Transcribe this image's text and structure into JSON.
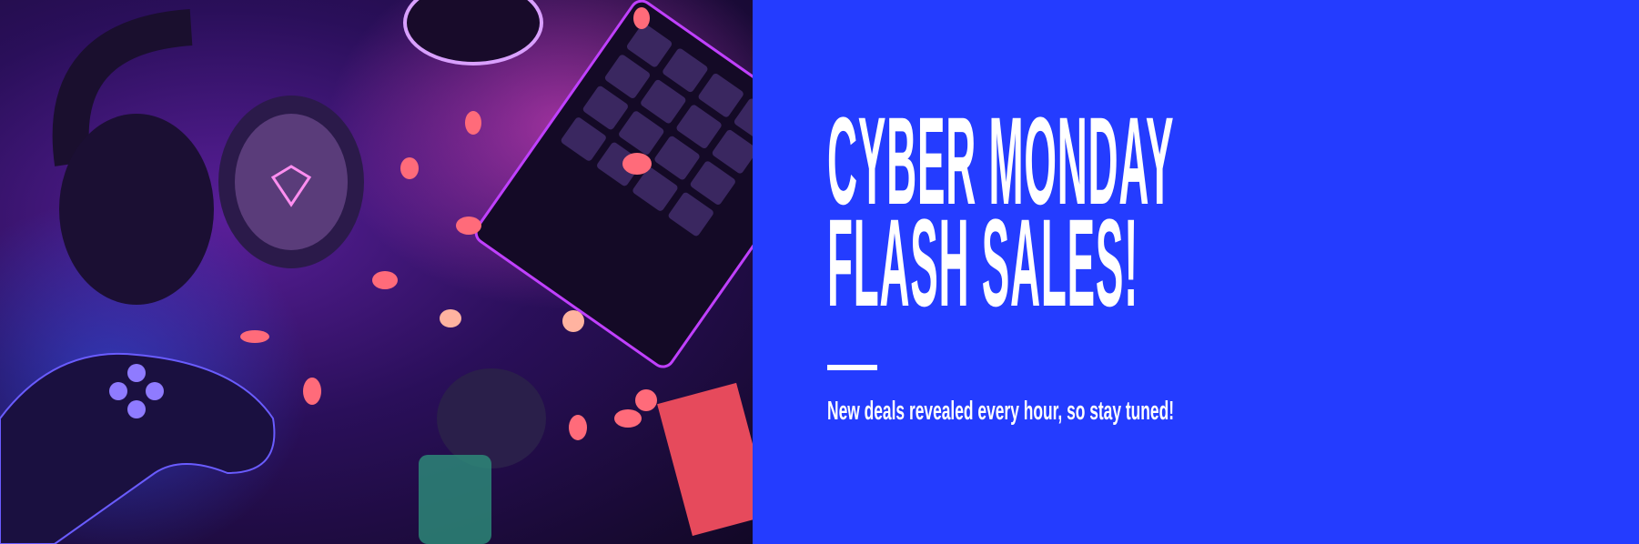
{
  "banner": {
    "title_line1": "CYBER MONDAY",
    "title_line2": "FLASH SALES!",
    "subtitle": "New deals revealed every hour, so stay tuned!",
    "background_color": "#243cff",
    "text_color": "#ffffff"
  }
}
